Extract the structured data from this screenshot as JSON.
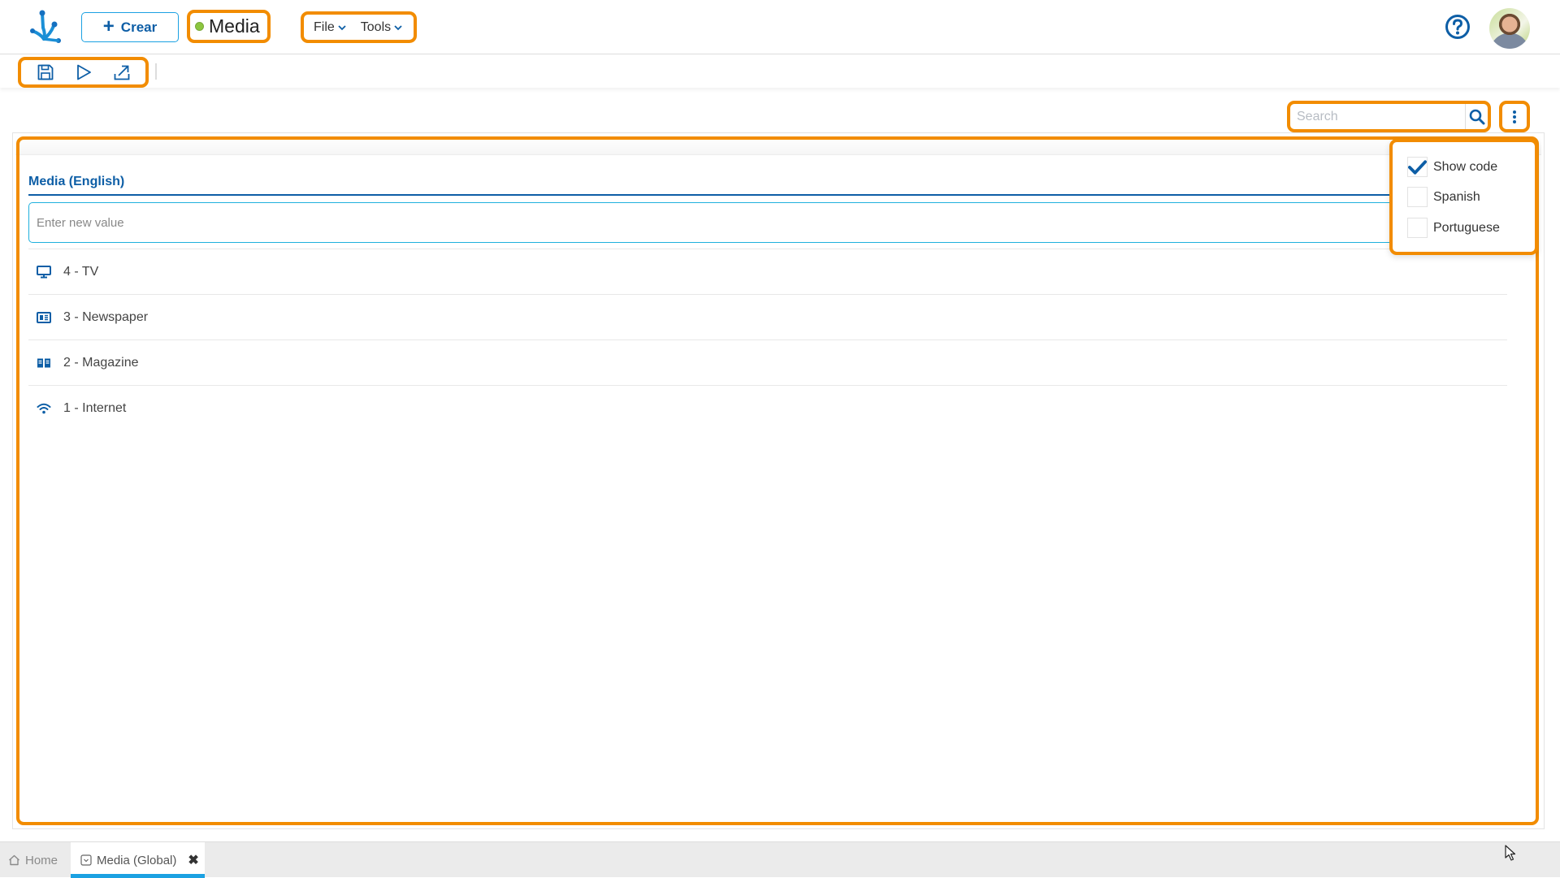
{
  "header": {
    "logo_icon": "app-logo-icon",
    "create_button": {
      "icon": "plus-icon",
      "label": "Crear"
    },
    "app_title": "Media",
    "status_color": "#8cc63f",
    "menus": [
      {
        "label": "File",
        "icon": "chevron-down-icon"
      },
      {
        "label": "Tools",
        "icon": "chevron-down-icon"
      }
    ],
    "help_icon": "help-circle-icon",
    "avatar": "user-avatar"
  },
  "toolbar": {
    "buttons": [
      {
        "name": "save",
        "icon": "save-icon"
      },
      {
        "name": "run",
        "icon": "play-icon"
      },
      {
        "name": "export",
        "icon": "export-icon"
      }
    ]
  },
  "search": {
    "placeholder": "Search",
    "value": "",
    "icon": "search-icon"
  },
  "options_button": {
    "icon": "kebab-menu-icon"
  },
  "field": {
    "label": "Media (English)",
    "input_placeholder": "Enter new value",
    "input_value": ""
  },
  "items": [
    {
      "code": "4",
      "label": "4 - TV",
      "icon": "monitor-icon"
    },
    {
      "code": "3",
      "label": "3 - Newspaper",
      "icon": "newspaper-icon"
    },
    {
      "code": "2",
      "label": "2 - Magazine",
      "icon": "book-open-icon"
    },
    {
      "code": "1",
      "label": "1 - Internet",
      "icon": "wifi-icon"
    }
  ],
  "options_menu": [
    {
      "label": "Show code",
      "checked": true
    },
    {
      "label": "Spanish",
      "checked": false
    },
    {
      "label": "Portuguese",
      "checked": false
    }
  ],
  "tabs": [
    {
      "label": "Home",
      "icon": "home-icon",
      "active": false
    },
    {
      "label": "Media (Global)",
      "icon": "list-box-icon",
      "active": true,
      "close_icon": "close-icon"
    }
  ],
  "colors": {
    "accent": "#0d5ea6",
    "highlight": "#f28c00",
    "active_tab": "#1ba1e2"
  }
}
